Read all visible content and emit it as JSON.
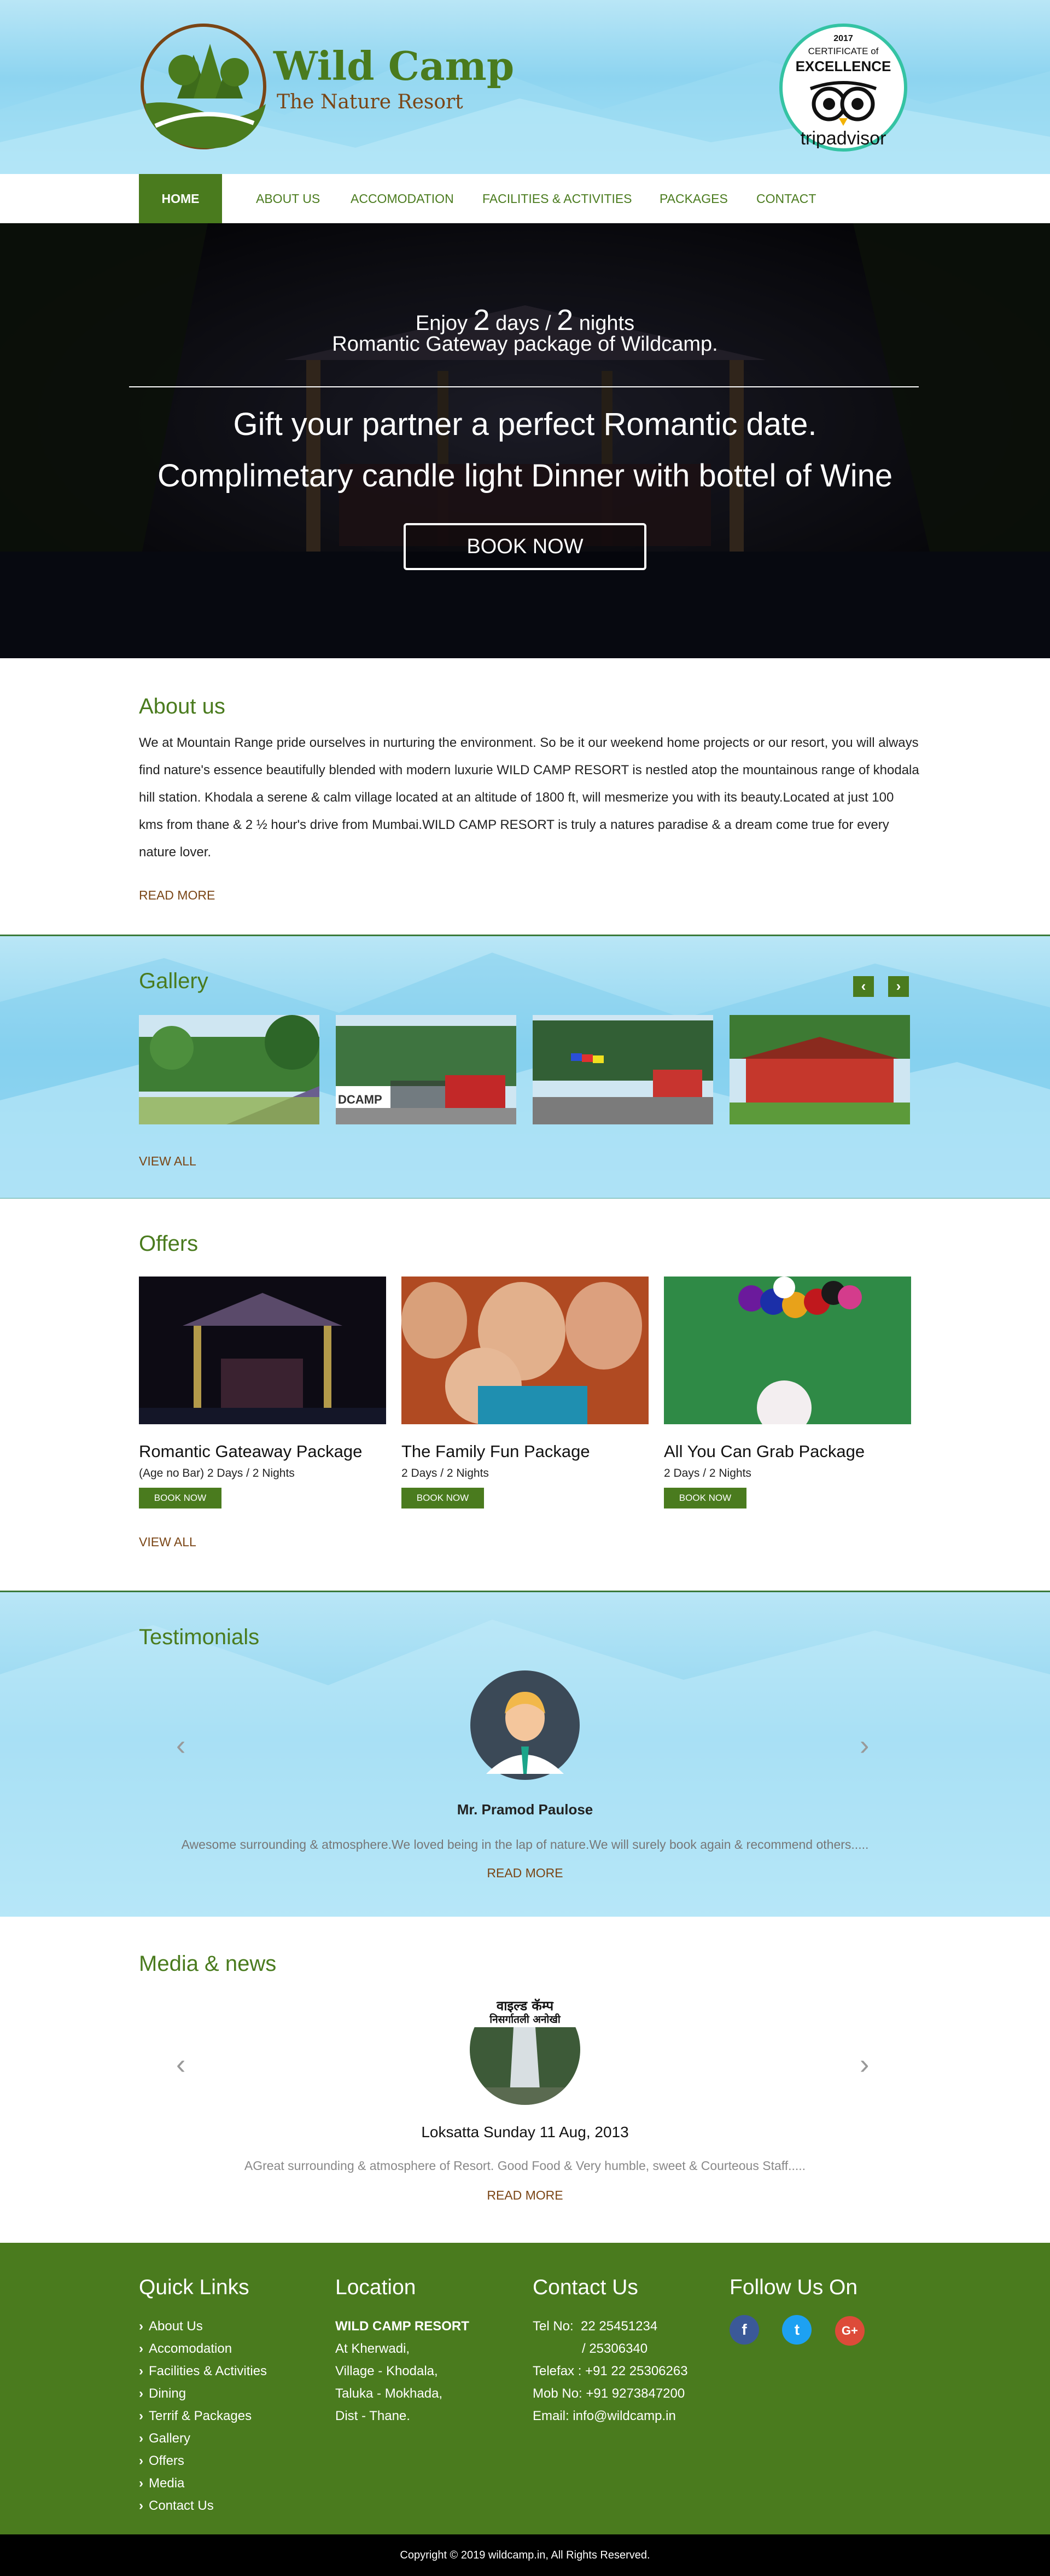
{
  "brand": {
    "name": "Wild Camp",
    "tagline": "The Nature Resort",
    "green": "#4a7b1e",
    "brown": "#7a4515"
  },
  "badge": {
    "year": "2017",
    "line1": "CERTIFICATE of",
    "line2": "EXCELLENCE",
    "brand": "tripadvisor"
  },
  "nav": [
    {
      "label": "HOME"
    },
    {
      "label": "ABOUT US"
    },
    {
      "label": "ACCOMODATION"
    },
    {
      "label": "FACILITIES & ACTIVITIES"
    },
    {
      "label": "PACKAGES"
    },
    {
      "label": "CONTACT"
    }
  ],
  "hero": {
    "enjoy": "Enjoy",
    "days_num": "2",
    "days_word": "days /",
    "nights_num": "2",
    "nights_word": "nights",
    "line2": "Romantic Gateway package of Wildcamp.",
    "headline1": "Gift your partner a perfect Romantic date.",
    "headline2": "Complimetary candle light Dinner with bottel of Wine",
    "cta": "BOOK NOW"
  },
  "about": {
    "title": "About us",
    "body": "We at Mountain Range pride ourselves in nurturing the environment. So be it our weekend home projects or our resort, you will always find nature's essence beautifully blended with modern luxurie WILD CAMP RESORT is nestled atop the mountainous range of khodala hill station. Khodala a serene & calm village located at an altitude of 1800 ft, will mesmerize you with its beauty.Located at just 100 kms from thane & 2 ½ hour's drive from Mumbai.WILD CAMP RESORT is truly a natures paradise & a dream come true for every nature lover.",
    "read_more": "READ MORE"
  },
  "gallery": {
    "title": "Gallery",
    "prev": "‹",
    "next": "›",
    "view_all": "VIEW ALL",
    "sign_text": "DCAMP"
  },
  "offers": {
    "title": "Offers",
    "items": [
      {
        "title": "Romantic Gateaway Package",
        "sub": "(Age no Bar) 2 Days / 2 Nights",
        "btn": "BOOK NOW"
      },
      {
        "title": "The Family Fun Package",
        "sub": "2 Days / 2 Nights",
        "btn": "BOOK NOW"
      },
      {
        "title": "All You Can Grab Package",
        "sub": "2 Days / 2 Nights",
        "btn": "BOOK NOW"
      }
    ],
    "view_all": "VIEW ALL"
  },
  "testimonials": {
    "title": "Testimonials",
    "prev": "‹",
    "next": "›",
    "name": "Mr. Pramod Paulose",
    "quote": "Awesome surrounding & atmosphere.We loved being in the lap of nature.We will surely book again & recommend others.....",
    "read_more": "READ MORE"
  },
  "media": {
    "title": "Media & news",
    "prev": "‹",
    "next": "›",
    "paper_text1": "वाइल्ड कॅम्प",
    "paper_text2": "निसर्गातली अनोखी",
    "headline": "Loksatta Sunday 11 Aug, 2013",
    "summary": "AGreat surrounding & atmosphere of Resort. Good Food & Very humble, sweet & Courteous Staff.....",
    "read_more": "READ MORE"
  },
  "footer": {
    "quick_links_title": "Quick Links",
    "quick_links": [
      "About Us",
      "Accomodation",
      "Facilities & Activities",
      "Dining",
      "Terrif & Packages",
      "Gallery",
      "Offers",
      "Media",
      "Contact Us"
    ],
    "location_title": "Location",
    "location_name": "WILD CAMP RESORT",
    "location_lines": [
      "At Kherwadi,",
      "Village - Khodala,",
      "Taluka - Mokhada,",
      "Dist - Thane."
    ],
    "contact_title": "Contact Us",
    "contact_lines": [
      "Tel No:  22 25451234",
      "/ 25306340",
      "Telefax : +91 22 25306263",
      "Mob No: +91 9273847200",
      "Email: info@wildcamp.in"
    ],
    "follow_title": "Follow Us On",
    "social": [
      {
        "icon": "facebook-icon",
        "glyph": "f",
        "color": "#3b5998"
      },
      {
        "icon": "twitter-icon",
        "glyph": "t",
        "color": "#1da1f2"
      },
      {
        "icon": "google-plus-icon",
        "glyph": "G+",
        "color": "#dd4b39"
      }
    ]
  },
  "copyright": "Copyright © 2019 wildcamp.in, All Rights Reserved."
}
